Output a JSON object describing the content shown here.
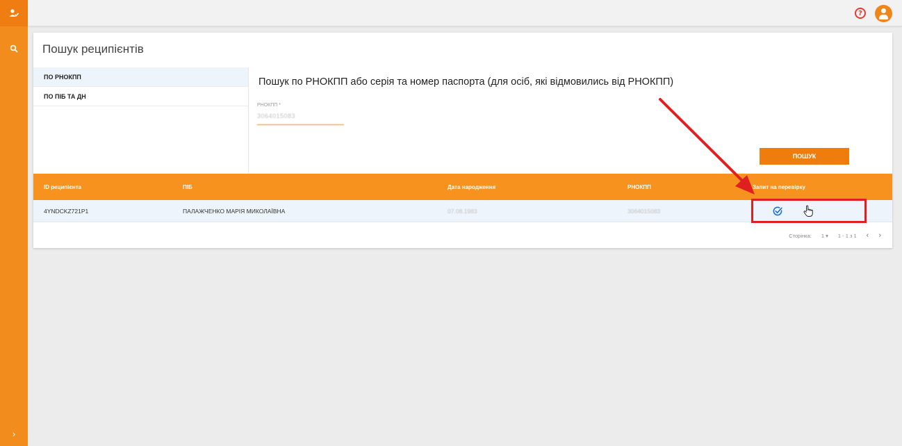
{
  "sidebar": {
    "logo_icon": "user-check-icon",
    "search_icon": "search-icon",
    "expand_icon": "chevron-right-icon",
    "expand_glyph": "›"
  },
  "topbar": {
    "help_glyph": "?",
    "help_icon": "help-circle-icon",
    "avatar_icon": "person-icon"
  },
  "page": {
    "title": "Пошук реципієнтів",
    "tabs": [
      {
        "label": "ПО РНОКПП",
        "active": true
      },
      {
        "label": "ПО ПІБ ТА ДН",
        "active": false
      }
    ],
    "heading": "Пошук по РНОКПП або серія та номер паспорта (для осіб, які відмовились від РНОКПП)",
    "rnokpp_label": "РНОКПП *",
    "rnokpp_value": "3064015083",
    "search_button": "ПОШУК"
  },
  "table": {
    "columns": [
      "ID реципієнта",
      "ПІБ",
      "Дата народження",
      "РНОКПП",
      "Запит на перевірку"
    ],
    "rows": [
      {
        "id": "4YNDCKZ721P1",
        "name": "ПАЛАЖЧЕНКО МАРІЯ МИКОЛАЇВНА",
        "birth_date": "07.08.1983",
        "rnokpp": "3064015083"
      }
    ]
  },
  "pager": {
    "label": "Сторінка:",
    "page": "1",
    "range": "1 - 1 з 1",
    "prev": "‹",
    "next": "›"
  },
  "colors": {
    "accent": "#f7921e",
    "button": "#ee7d0e",
    "annotation": "#e02020",
    "check": "#1e6fd9"
  }
}
